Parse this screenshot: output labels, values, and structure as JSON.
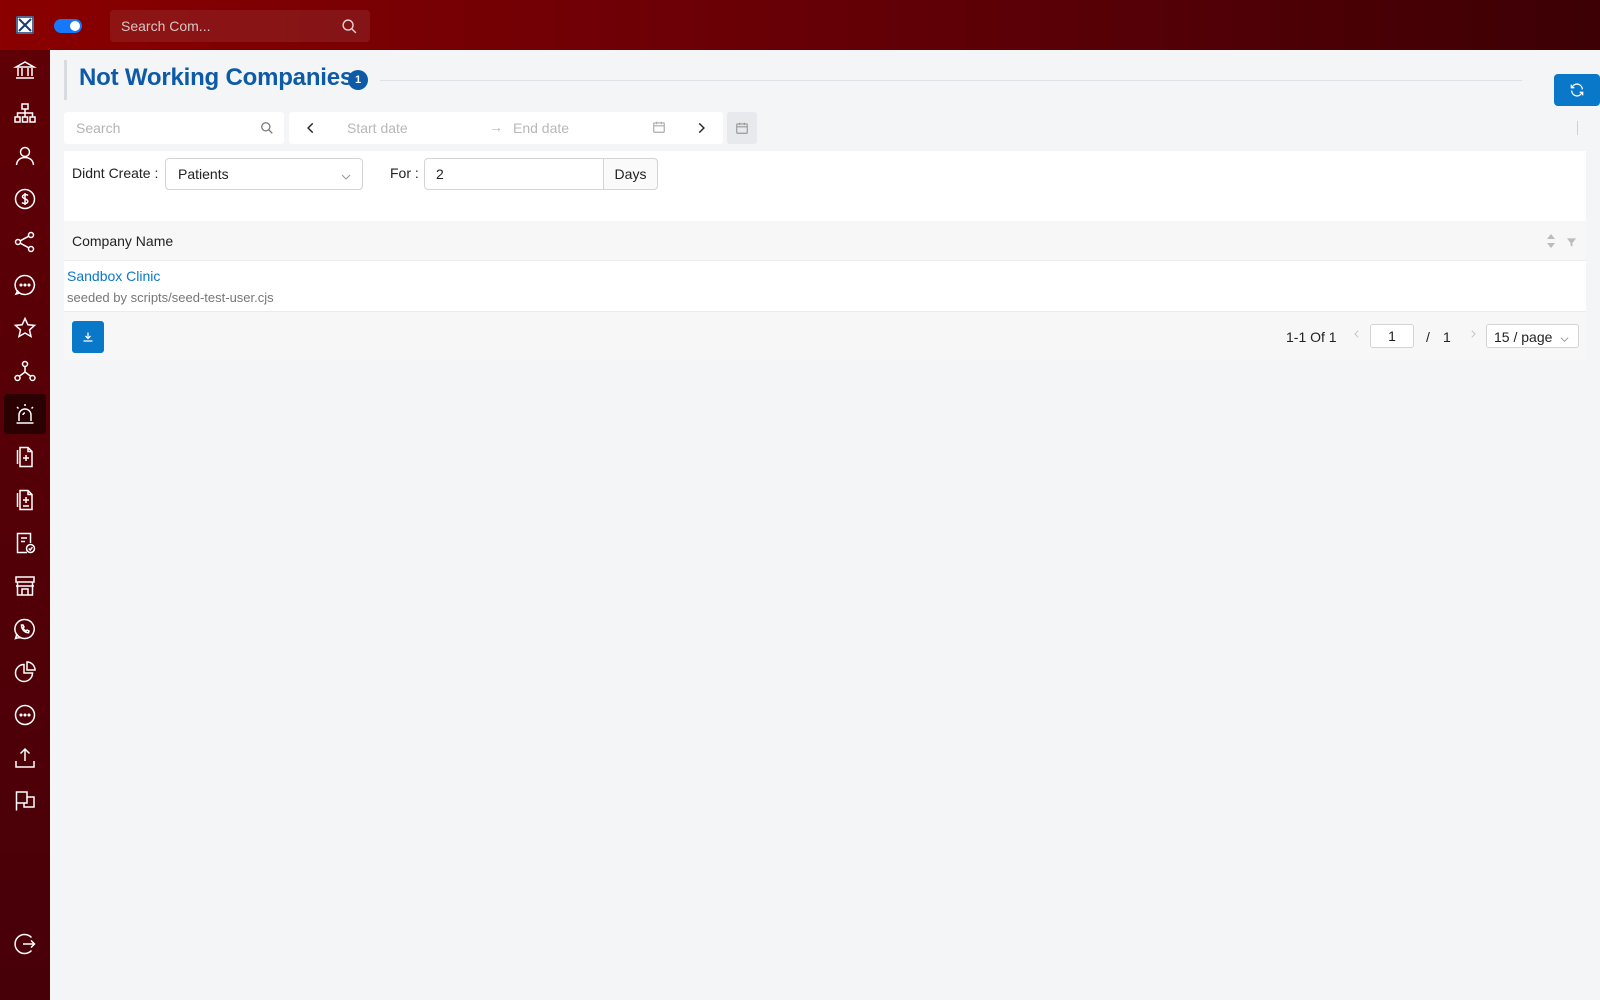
{
  "topbar": {
    "logo_icon": "app-logo-icon",
    "search_placeholder": "Search Com..."
  },
  "sidebar": {
    "items": [
      {
        "icon": "bank-icon"
      },
      {
        "icon": "org-chart-icon"
      },
      {
        "icon": "user-icon"
      },
      {
        "icon": "dollar-icon"
      },
      {
        "icon": "share-icon"
      },
      {
        "icon": "chat-icon"
      },
      {
        "icon": "star-icon"
      },
      {
        "icon": "network-icon"
      },
      {
        "icon": "alarm-icon",
        "active": true
      },
      {
        "icon": "document-add-icon"
      },
      {
        "icon": "document-list-icon"
      },
      {
        "icon": "document-check-icon"
      },
      {
        "icon": "store-icon"
      },
      {
        "icon": "phone-icon"
      },
      {
        "icon": "pie-chart-icon"
      },
      {
        "icon": "chat-dots-icon"
      },
      {
        "icon": "upload-icon"
      },
      {
        "icon": "flag-icon"
      },
      {
        "icon": "logout-icon"
      }
    ]
  },
  "page": {
    "title": "Not Working Companies",
    "count_badge": "1"
  },
  "filters": {
    "search_placeholder": "Search",
    "start_placeholder": "Start date",
    "end_placeholder": "End date",
    "didnt_create_label": "Didnt Create :",
    "didnt_create_value": "Patients",
    "for_label": "For :",
    "for_value": "2",
    "days_label": "Days"
  },
  "table": {
    "columns": [
      "Company Name"
    ],
    "rows": [
      {
        "name": "Sandbox Clinic",
        "note": "seeded by scripts/seed-test-user.cjs"
      }
    ]
  },
  "pagination": {
    "total": "1-1 Of 1",
    "current_page": "1",
    "slash": "/",
    "total_pages": "1",
    "page_size": "15 / page"
  },
  "colors": {
    "accent": "#0a78c9",
    "title": "#0d5aa7",
    "topbar": "#7a0005"
  }
}
